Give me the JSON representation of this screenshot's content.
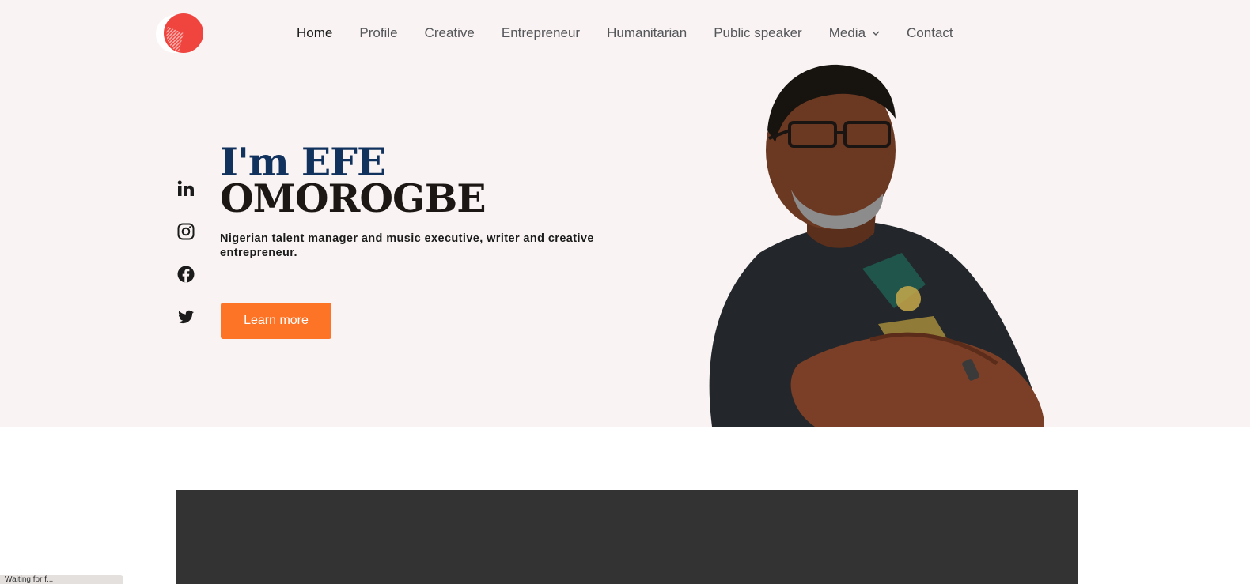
{
  "nav": {
    "items": [
      {
        "label": "Home",
        "active": true
      },
      {
        "label": "Profile"
      },
      {
        "label": "Creative"
      },
      {
        "label": "Entrepreneur"
      },
      {
        "label": "Humanitarian"
      },
      {
        "label": "Public speaker"
      },
      {
        "label": "Media",
        "has_dropdown": true
      },
      {
        "label": "Contact"
      }
    ]
  },
  "hero": {
    "title_line1": "I'm EFE",
    "title_line2": "OMOROGBE",
    "subtitle": "Nigerian talent manager and music executive, writer and creative entrepreneur.",
    "cta_label": "Learn more"
  },
  "socials": [
    "linkedin-icon",
    "instagram-icon",
    "facebook-icon",
    "twitter-icon"
  ],
  "status_bar": {
    "text": "Waiting for f..."
  },
  "colors": {
    "hero_bg": "#f9f4f3",
    "accent": "#fd7427",
    "title_blue": "#12325e",
    "title_dark": "#1c1714",
    "logo_red": "#f0443f",
    "video_bg": "#333333"
  }
}
